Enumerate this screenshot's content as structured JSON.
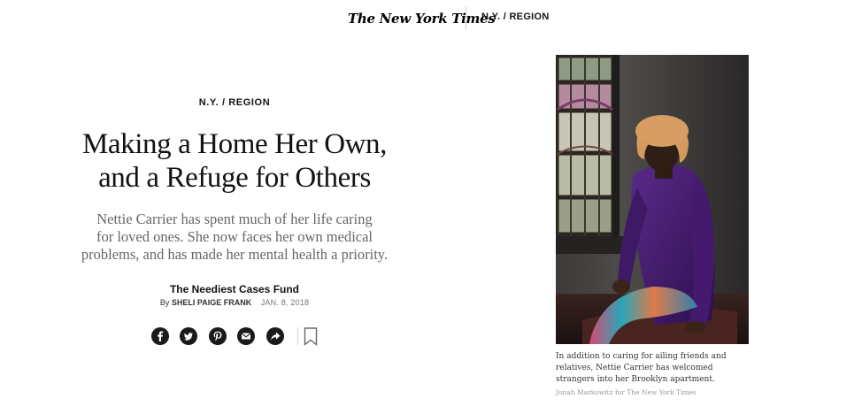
{
  "header": {
    "logo_text": "The New York Times",
    "section_link": "N.Y. / REGION"
  },
  "article": {
    "kicker": "N.Y. / REGION",
    "headline_lines": [
      "Making a Home Her Own,",
      "and a Refuge for Others"
    ],
    "summary_lines": [
      "Nettie Carrier has spent much of her life caring",
      "for loved ones. She now faces her own medical",
      "problems, and has made her mental health a priority."
    ],
    "column_name": "The Neediest Cases Fund",
    "byline_prefix": "By",
    "author": "SHELI PAIGE FRANK",
    "date": "JAN. 8, 2018"
  },
  "share_tools": [
    {
      "name": "facebook-icon",
      "label": "f"
    },
    {
      "name": "twitter-icon",
      "label": "twitter"
    },
    {
      "name": "pinterest-icon",
      "label": "P"
    },
    {
      "name": "email-icon",
      "label": "email"
    },
    {
      "name": "share-icon",
      "label": "more"
    }
  ],
  "save_icon": "bookmark-icon",
  "lede_image": {
    "caption_lines": [
      "In addition to caring for ailing friends and",
      "relatives, Nettie Carrier has welcomed",
      "strangers into her Brooklyn apartment."
    ],
    "credit": "Jonah Markowitz for The New York Times"
  },
  "colors": {
    "text": "#121212",
    "summary": "#666666",
    "share_button": "#1a1a1a"
  }
}
